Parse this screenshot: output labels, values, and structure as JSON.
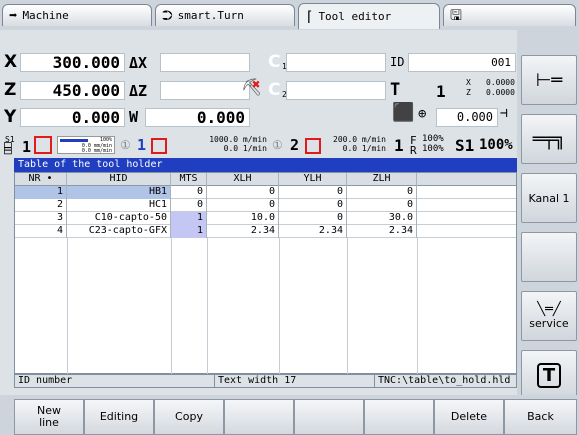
{
  "tabs": [
    {
      "label": "Machine",
      "icon": "arrow-right-icon"
    },
    {
      "label": "smart.Turn",
      "icon": "smart-turn-icon"
    },
    {
      "label": "Tool editor",
      "icon": "tool-icon"
    },
    {
      "label": "",
      "icon": "disk-icon"
    }
  ],
  "axes": {
    "x": {
      "label": "X",
      "value": "300.000",
      "delta": "ΔX"
    },
    "z": {
      "label": "Z",
      "value": "450.000",
      "delta": "ΔZ"
    },
    "y": {
      "label": "Y",
      "value": "0.000",
      "w_label": "W",
      "w_value": "0.000"
    },
    "c1": "C",
    "c1_sub": "1",
    "c2": "C",
    "c2_sub": "2",
    "id_label": "ID",
    "id_value": "001",
    "t_label": "T",
    "t_value": "1",
    "tx_label": "X",
    "tx_value": "0.0000",
    "tz_label": "Z",
    "tz_value": "0.0000",
    "tool_offset": "0.000"
  },
  "spindle": {
    "s1_label": "S1",
    "s1_num": "1",
    "feed_pct": "100%",
    "feed_line1": "0.0 mm/min",
    "feed_line2": "0.0 mm/min",
    "ch1": "1",
    "ch1_line1": "1000.0 m/min",
    "ch1_line2": "0.0 1/min",
    "ch2": "2",
    "ch2_line1": "200.0 m/min",
    "ch2_line2": "0.0 1/min",
    "f_label": "F",
    "r_label": "R",
    "f_pct": "100%",
    "r_pct": "100%",
    "big_one": "1",
    "s1_pct_label": "S1",
    "s1_pct": "100%"
  },
  "table": {
    "title": "Table of the tool holder",
    "columns": [
      "NR",
      "HID",
      "MTS",
      "XLH",
      "YLH",
      "ZLH"
    ],
    "rows": [
      [
        "1",
        "HB1",
        "0",
        "0",
        "0",
        "0"
      ],
      [
        "2",
        "HC1",
        "0",
        "0",
        "0",
        "0"
      ],
      [
        "3",
        "C10-capto-50",
        "1",
        "10.0",
        "0",
        "30.0"
      ],
      [
        "4",
        "C23-capto-GFX",
        "1",
        "2.34",
        "2.34",
        "2.34"
      ]
    ],
    "status": {
      "field": "ID number",
      "width": "Text width 17",
      "path": "TNC:\\table\\to_hold.hld"
    }
  },
  "side_buttons": [
    {
      "label": "",
      "icon": "toolholder-icon"
    },
    {
      "label": "",
      "icon": "spindle-icon"
    },
    {
      "label": "Kanal 1",
      "icon": ""
    },
    {
      "label": "",
      "icon": ""
    },
    {
      "label": "service",
      "icon": "wrench-icon"
    },
    {
      "label": "",
      "icon": "toggle-t-icon"
    }
  ],
  "softkeys": [
    "New\nline",
    "Editing",
    "Copy",
    "",
    "",
    "",
    "Delete",
    "Back"
  ],
  "colors": {
    "title_bar": "#1f3ec0",
    "selected": "#b0c4e8",
    "mts_highlight": "#c4c6f4",
    "red": "#e01b1b"
  }
}
